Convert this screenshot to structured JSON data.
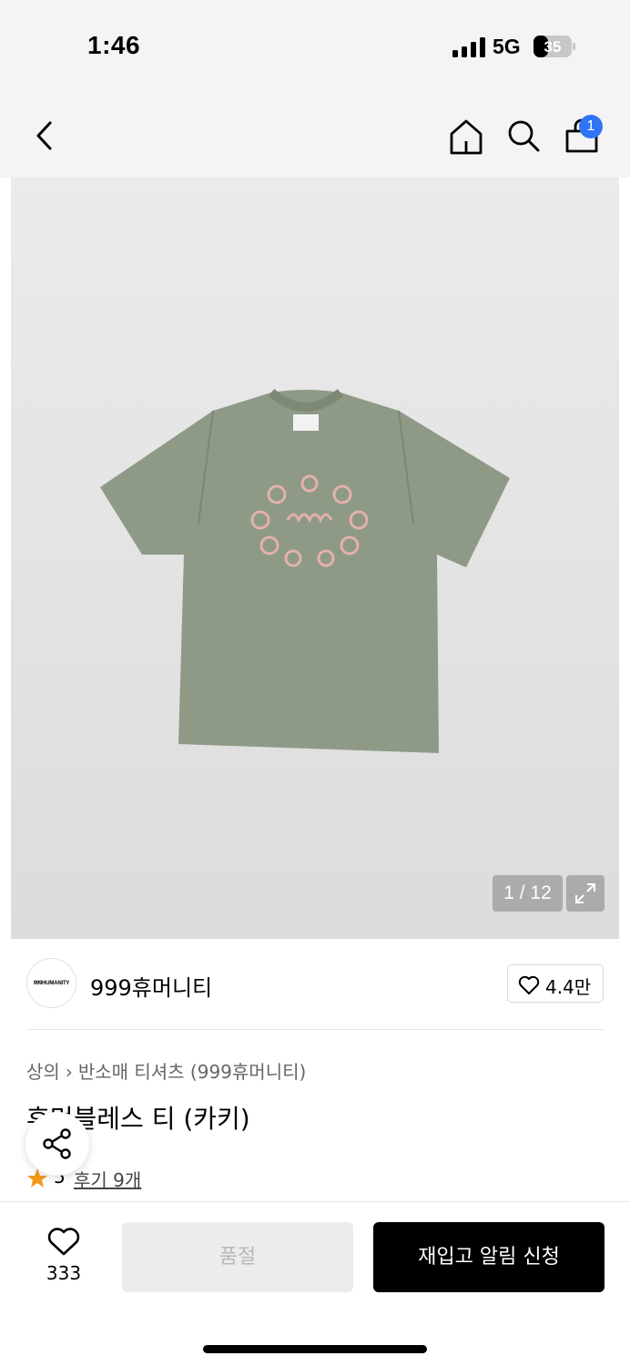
{
  "status_bar": {
    "time": "1:46",
    "network": "5G",
    "battery": "35"
  },
  "top_nav": {
    "cart_count": "1"
  },
  "gallery": {
    "counter": "1 / 12"
  },
  "brand": {
    "logo_text": "999HUMANITY",
    "name": "999휴머니티",
    "likes": "4.4만"
  },
  "breadcrumb": {
    "category": "상의",
    "subcategory": "반소매 티셔츠 (999휴머니티)"
  },
  "product": {
    "title": "휴먼블레스 티 (카키)"
  },
  "rating": {
    "value": "5",
    "reviews_label": "후기 9개"
  },
  "bottom_bar": {
    "wish_count": "333",
    "soldout_label": "품절",
    "restock_label": "재입고 알림 신청"
  },
  "colors": {
    "accent_blue": "#2f74f5",
    "star": "#f39a1e",
    "shirt": "#8e9a86",
    "embroidery": "#e2b2aa"
  }
}
